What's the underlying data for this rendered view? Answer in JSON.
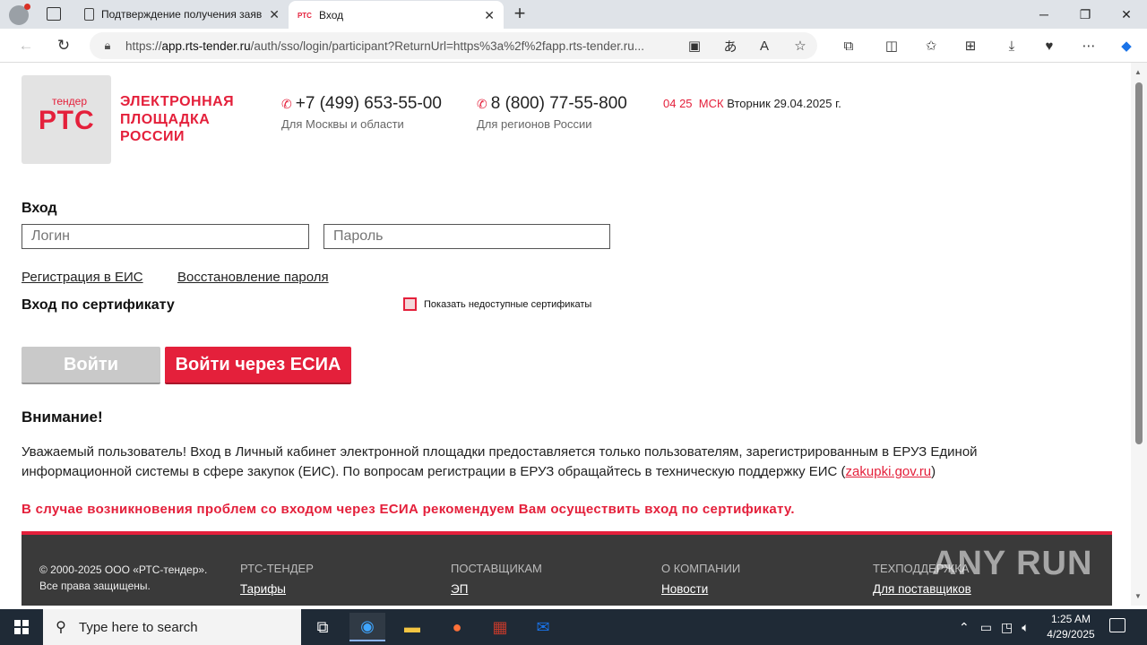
{
  "browser": {
    "tabs": [
      {
        "title": "Подтверждение получения заяв",
        "favicon": "document-icon"
      },
      {
        "title": "Вход",
        "favicon": "РТС"
      }
    ],
    "url_prefix": "https://",
    "url_host": "app.rts-tender.ru",
    "url_rest": "/auth/sso/login/participant?ReturnUrl=https%3a%2f%2fapp.rts-tender.ru..."
  },
  "header": {
    "logo_small": "тендер",
    "logo_big": "РТС",
    "logo_text_1": "ЭЛЕКТРОННАЯ",
    "logo_text_2": "ПЛОЩАДКА",
    "logo_text_3": "РОССИИ",
    "phone1": "+7 (499) 653-55-00",
    "phone1_sub": "Для Москвы и области",
    "phone2": "8 (800) 77-55-800",
    "phone2_sub": "Для регионов России",
    "time": "04 25",
    "tz": "МСК",
    "date": "Вторник 29.04.2025 г."
  },
  "login": {
    "heading": "Вход",
    "login_placeholder": "Логин",
    "password_placeholder": "Пароль",
    "register_link": "Регистрация в ЕИС",
    "restore_link": "Восстановление пароля",
    "cert_heading": "Вход по сертификату",
    "show_unavailable": "Показать недоступные сертификаты",
    "login_button": "Войти",
    "esia_button": "Войти через ЕСИА"
  },
  "notice": {
    "heading": "Внимание!",
    "text_1": "Уважаемый пользователь! Вход в Личный кабинет электронной площадки предоставляется только пользователям, зарегистрированным в ЕРУЗ Единой информационной системы в сфере закупок (ЕИС). По вопросам регистрации в ЕРУЗ обращайтесь в техническую поддержку ЕИС (",
    "link": "zakupki.gov.ru",
    "text_2": ")",
    "red_warning": "В случае возникновения проблем со входом через ЕСИА рекомендуем Вам осуществить вход по сертификату."
  },
  "footer": {
    "copy_1": "© 2000-2025 ООО «РТС-тендер».",
    "copy_2": "Все права защищены.",
    "columns": [
      {
        "heading": "РТС-ТЕНДЕР",
        "item": "Тарифы"
      },
      {
        "heading": "ПОСТАВЩИКАМ",
        "item": "ЭП"
      },
      {
        "heading": "О КОМПАНИИ",
        "item": "Новости"
      },
      {
        "heading": "ТЕХПОДДЕРЖКА",
        "item": "Для поставщиков"
      }
    ]
  },
  "watermark": "ANY RUN",
  "taskbar": {
    "search_placeholder": "Type here to search",
    "time": "1:25 AM",
    "date": "4/29/2025"
  },
  "colors": {
    "accent": "#e4203b",
    "footer": "#3a3a3a",
    "taskbar": "#1f2a36"
  }
}
